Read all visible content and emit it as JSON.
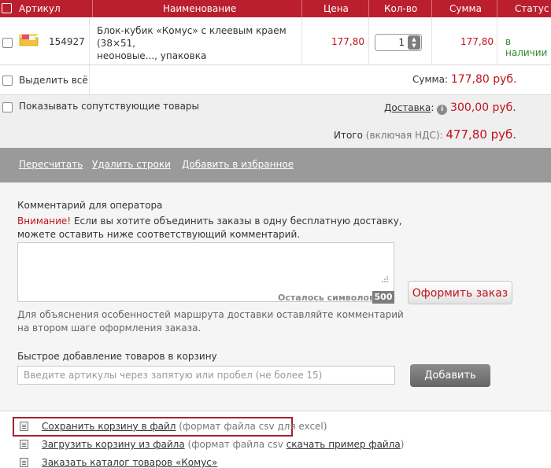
{
  "table": {
    "headers": [
      "Артикул",
      "Наименование",
      "Цена",
      "Кол-во",
      "Сумма",
      "Статус"
    ],
    "item": {
      "sku": "154927",
      "name_line1": "Блок-кубик «Комус» с клеевым краем",
      "name_line2": "(38×51,",
      "name_line3": "неоновые..., упаковка",
      "price": "177,80",
      "quantity": "1",
      "sum": "177,80",
      "status": "в наличии"
    }
  },
  "select_all_label": "Выделить всё",
  "sum": {
    "label": "Сумма:",
    "value": "177,80 руб."
  },
  "show_related_label": "Показывать сопутствующие товары",
  "delivery": {
    "label": "Доставка",
    "colon": ":",
    "value": "300,00 руб."
  },
  "total": {
    "label": "Итого",
    "vat_note": "(включая НДС):",
    "value": "477,80 руб."
  },
  "actions": {
    "recalculate": "Пересчитать",
    "delete_rows": "Удалить строки",
    "add_to_favorites": "Добавить в избранное"
  },
  "comment": {
    "title": "Комментарий для оператора",
    "attention": "Внимание!",
    "notice_line1": " Если вы хотите объединить заказы в одну бесплатную доставку,",
    "notice_line2": "можете оставить ниже соответствующий комментарий.",
    "chars_left_label": "Осталось символов:",
    "chars_left_value": "500",
    "hint_line1": "Для объяснения особенностей маршрута доставки оставляйте комментарий",
    "hint_line2": "на втором шаге оформления заказа."
  },
  "order_button": "Оформить заказ",
  "quick_add": {
    "title": "Быстрое добавление товаров в корзину",
    "placeholder": "Введите артикулы через запятую или пробел (не более 15)",
    "button": "Добавить"
  },
  "files": {
    "save_link": "Сохранить корзину в файл",
    "save_note": " (формат файла csv для excel)",
    "load_link": "Загрузить корзину из файла",
    "load_note": " (формат файла csv ",
    "sample_link": "скачать пример файла",
    "sample_close": ")",
    "catalog_link": "Заказать каталог товаров «Комус»"
  },
  "colors": {
    "brand_red": "#bb1f2e",
    "price_red": "#c0141d",
    "status_green": "#2a8a2a",
    "highlight_box": "#a1232f"
  }
}
